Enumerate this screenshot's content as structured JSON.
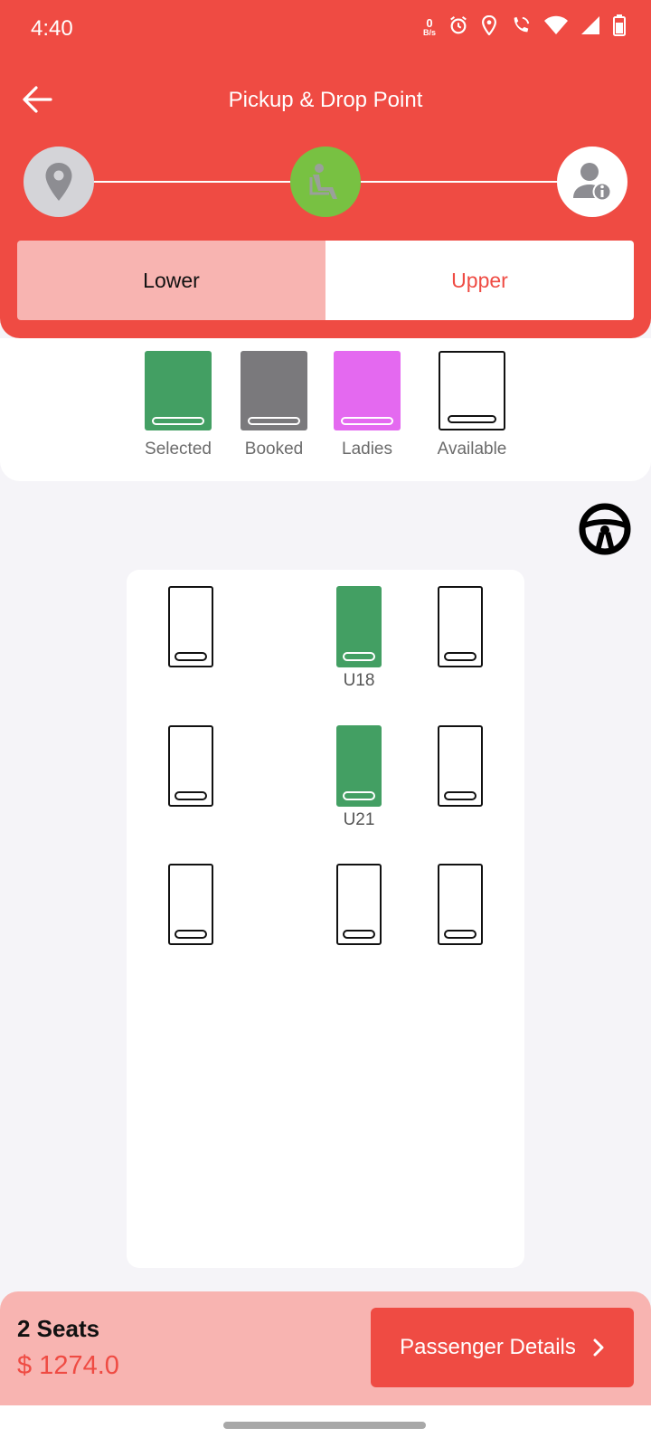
{
  "status_bar": {
    "time": "4:40",
    "net_speed_top": "0",
    "net_speed_bottom": "B/s"
  },
  "header": {
    "title": "Pickup & Drop Point"
  },
  "stepper": {
    "steps": [
      "location-pin-icon",
      "seat-icon",
      "user-info-icon"
    ],
    "active_step": 2,
    "colors": {
      "inactive": "#d4d4d8",
      "active": "#78c142"
    }
  },
  "deck_tabs": {
    "lower": "Lower",
    "upper": "Upper",
    "selected": "Lower"
  },
  "legend": [
    {
      "label": "Selected",
      "color": "#439f63"
    },
    {
      "label": "Booked",
      "color": "#7a797c"
    },
    {
      "label": "Ladies",
      "color": "#e469f0"
    },
    {
      "label": "Available",
      "color": "#ffffff"
    }
  ],
  "seats": {
    "selected": [
      {
        "label": "U18"
      },
      {
        "label": "U21"
      }
    ]
  },
  "bottom_bar": {
    "seat_count": "2 Seats",
    "price": "$ 1274.0",
    "button_label": "Passenger Details"
  },
  "colors": {
    "primary": "#ef4b43",
    "primary_light": "#f8b4b1",
    "selected_seat": "#439f63"
  }
}
